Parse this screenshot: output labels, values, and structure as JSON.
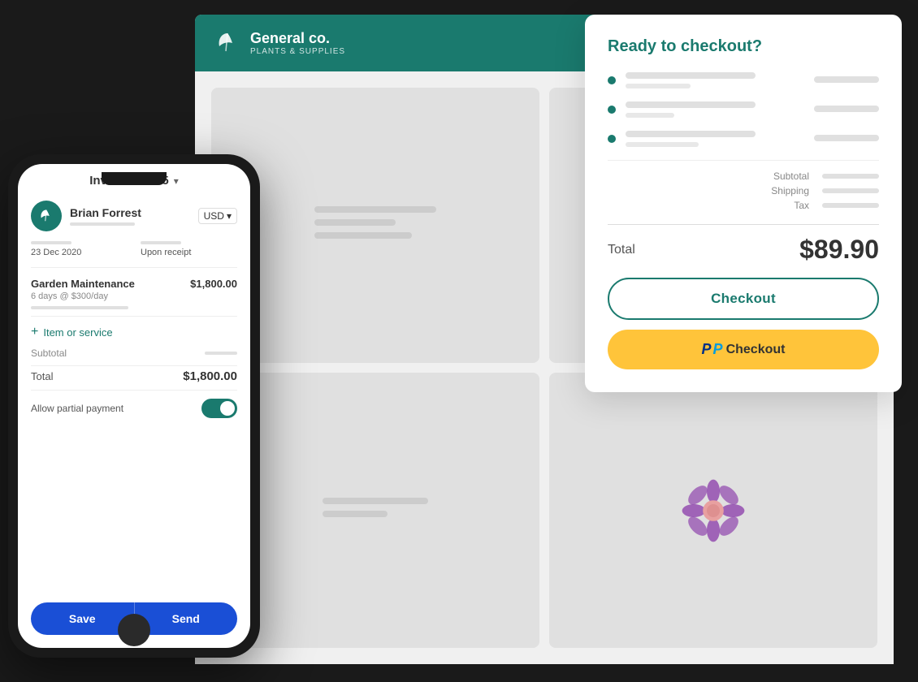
{
  "app": {
    "company_name": "General co.",
    "company_tagline": "PLANTS & SUPPLIES"
  },
  "invoice": {
    "number": "Invoice #0015",
    "client_name": "Brian Forrest",
    "currency": "USD",
    "date": "23 Dec 2020",
    "due": "Upon receipt",
    "item_name": "Garden Maintenance",
    "item_amount": "$1,800.00",
    "item_desc": "6 days @ $300/day",
    "add_item_label": "Item or service",
    "subtotal_label": "Subtotal",
    "total_label": "Total",
    "total_amount": "$1,800.00",
    "partial_payment_label": "Allow partial payment",
    "save_btn": "Save",
    "send_btn": "Send"
  },
  "checkout_modal": {
    "title": "Ready to checkout?",
    "total_label": "Total",
    "total_amount": "$89.90",
    "subtotal_label": "Subtotal",
    "shipping_label": "Shipping",
    "tax_label": "Tax",
    "checkout_btn": "Checkout",
    "paypal_p1": "P",
    "paypal_p2": "P",
    "paypal_checkout_text": "Checkout"
  }
}
